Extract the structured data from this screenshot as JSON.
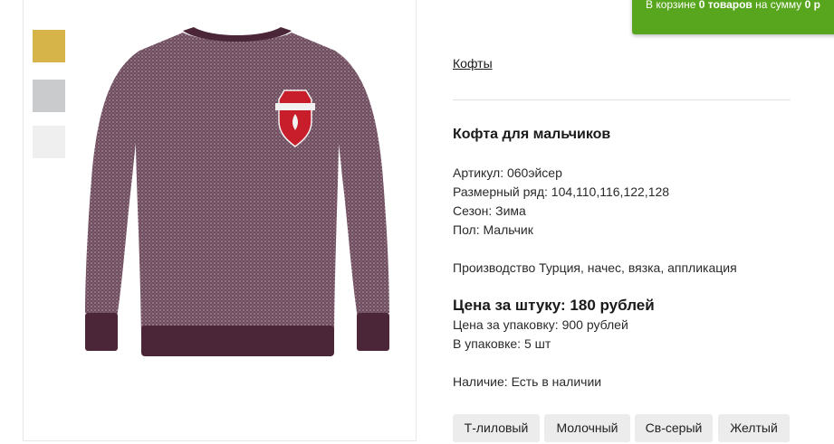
{
  "cart": {
    "text_prefix": "В корзине",
    "count": "0 товаров",
    "text_mid": "на сумму",
    "sum": "0 р"
  },
  "breadcrumb": {
    "category": "Кофты"
  },
  "product": {
    "title": "Кофта для мальчиков",
    "specs": [
      "Артикул: 060эйсер",
      "Размерный ряд: 104,110,116,122,128",
      "Сезон: Зима",
      "Пол: Мальчик"
    ],
    "description": "Производство Турция, начес, вязка, аппликация",
    "price_unit": "Цена за штуку: 180 рублей",
    "price_pack": "Цена за упаковку: 900 рублей",
    "pack_size": "В упаковке: 5 шт",
    "availability": "Наличие: Есть в наличии"
  },
  "color_swatches": [
    {
      "name": "yellow",
      "color": "#d7b44a"
    },
    {
      "name": "grey",
      "color": "#c9cbcd"
    },
    {
      "name": "white",
      "color": "#efefef"
    }
  ],
  "colors": [
    "Т-лиловый",
    "Молочный",
    "Св-серый",
    "Желтый"
  ],
  "theme": {
    "accent": "#58a51e",
    "product_color": "#6e4a5c"
  }
}
